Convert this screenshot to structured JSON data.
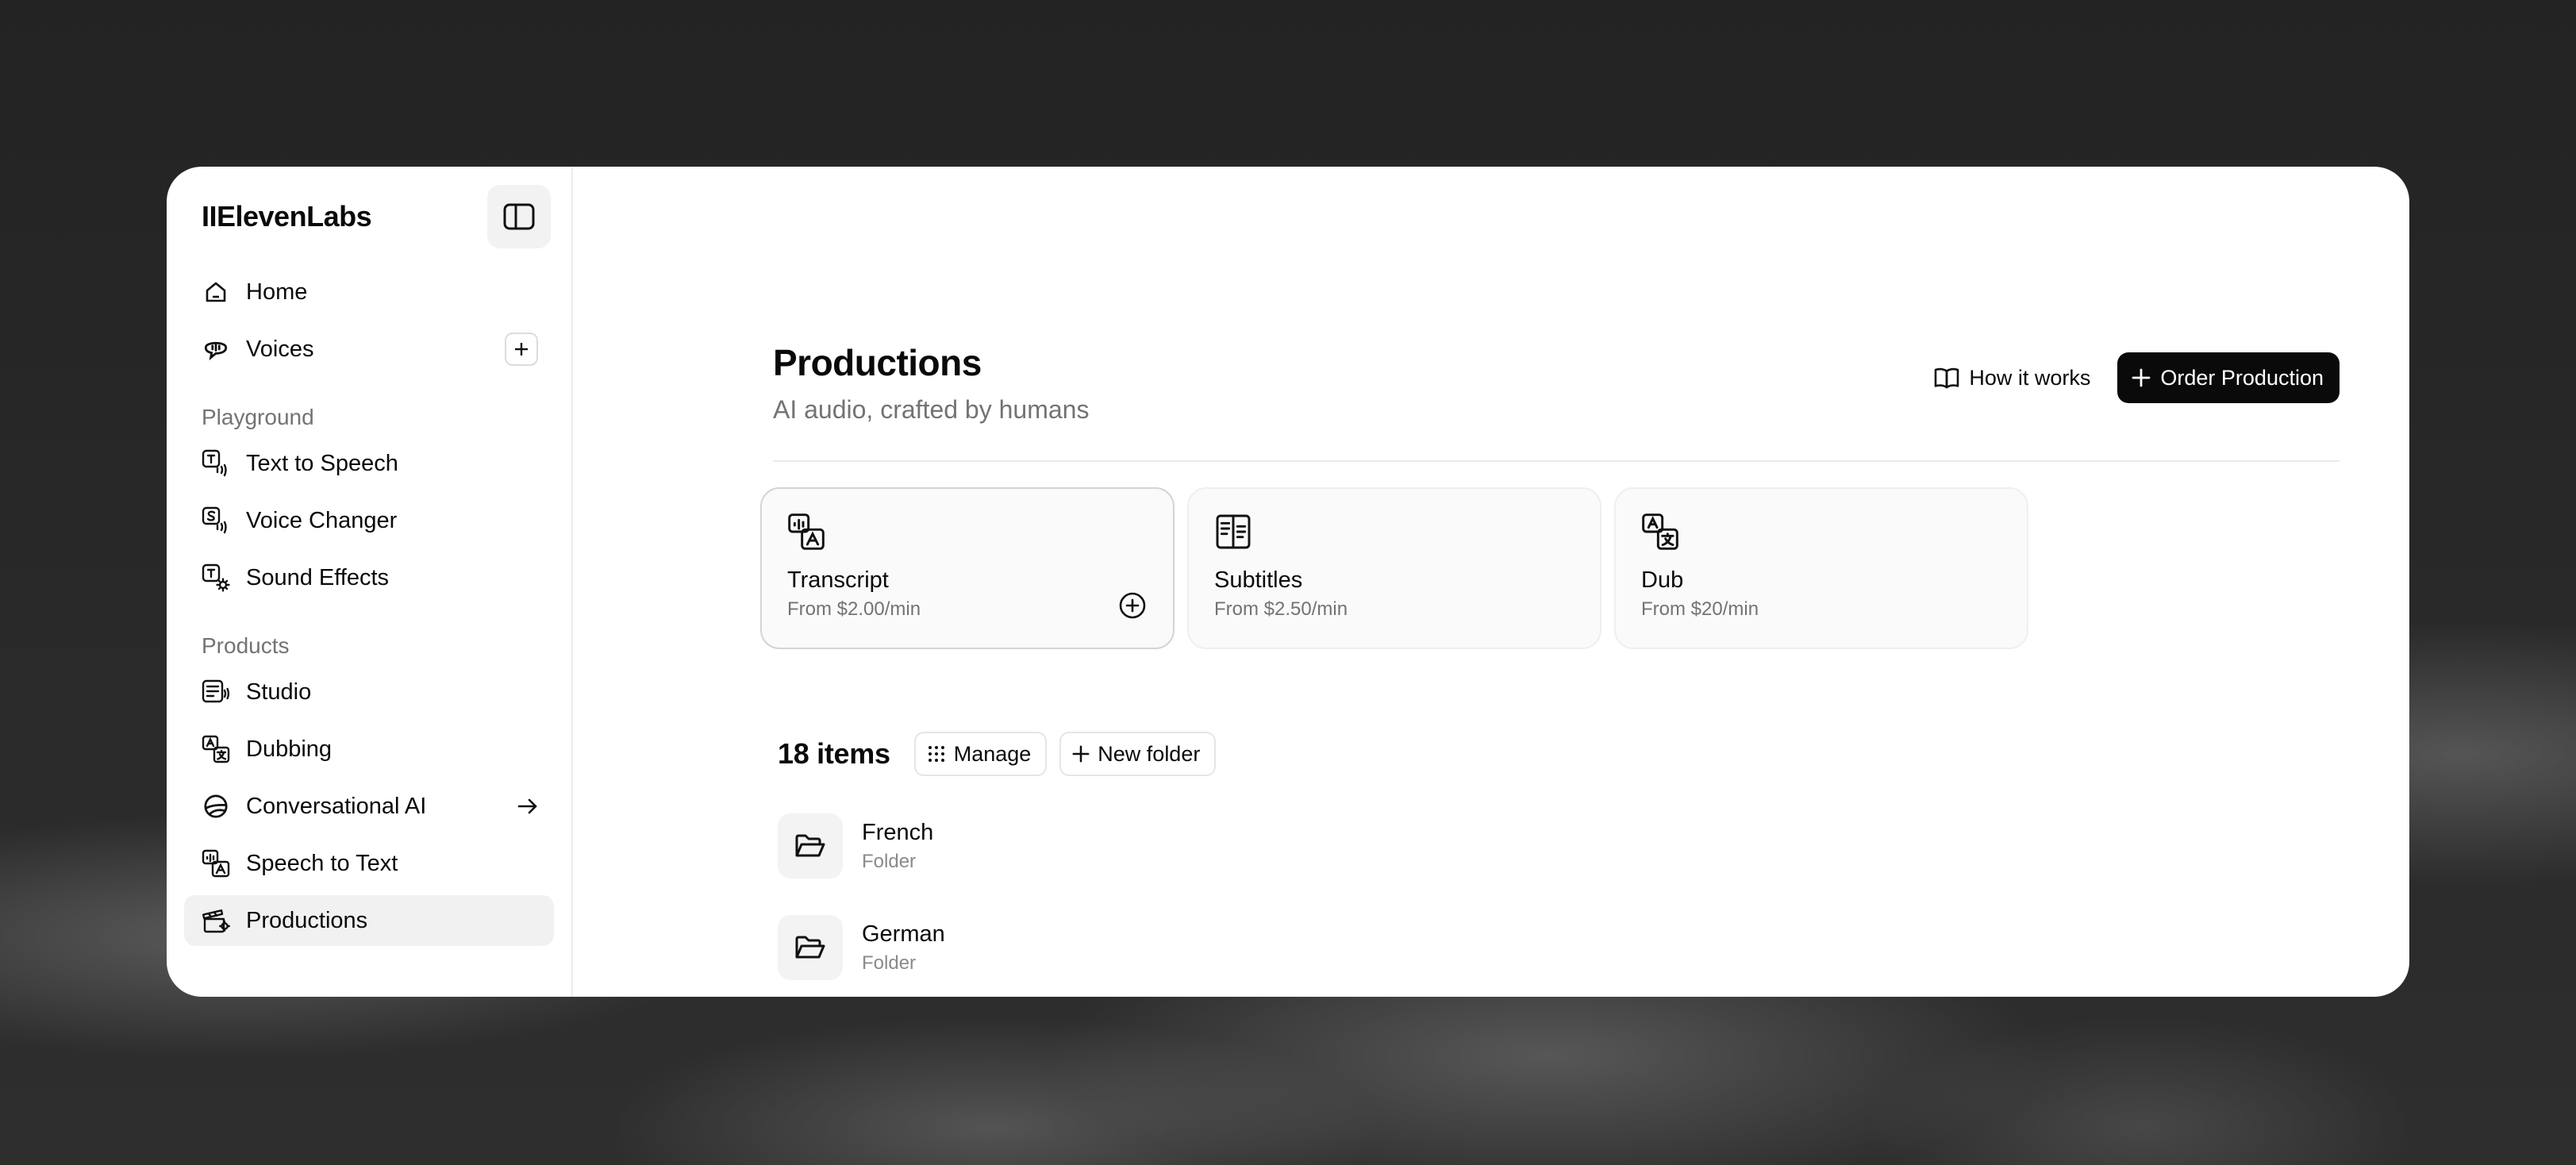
{
  "app": {
    "logo": "IIElevenLabs"
  },
  "sidebar": {
    "top_items": [
      {
        "label": "Home",
        "icon": "home-icon"
      },
      {
        "label": "Voices",
        "icon": "voices-icon"
      }
    ],
    "playground_label": "Playground",
    "playground_items": [
      {
        "label": "Text to Speech",
        "icon": "text-to-speech-icon"
      },
      {
        "label": "Voice Changer",
        "icon": "voice-changer-icon"
      },
      {
        "label": "Sound Effects",
        "icon": "sound-effects-icon"
      }
    ],
    "products_label": "Products",
    "product_items": [
      {
        "label": "Studio",
        "icon": "studio-icon"
      },
      {
        "label": "Dubbing",
        "icon": "dubbing-icon"
      },
      {
        "label": "Conversational AI",
        "icon": "conversational-ai-icon"
      },
      {
        "label": "Speech to Text",
        "icon": "speech-to-text-icon"
      },
      {
        "label": "Productions",
        "icon": "productions-icon",
        "active": true
      }
    ]
  },
  "header": {
    "title": "Productions",
    "subtitle": "AI audio, crafted by humans",
    "how_it_works": "How it works",
    "order_production": "Order Production"
  },
  "cards": [
    {
      "title": "Transcript",
      "price": "From $2.00/min",
      "icon": "transcript-icon",
      "selected": true
    },
    {
      "title": "Subtitles",
      "price": "From $2.50/min",
      "icon": "subtitles-icon"
    },
    {
      "title": "Dub",
      "price": "From $20/min",
      "icon": "dub-icon"
    }
  ],
  "list": {
    "count": "18 items",
    "manage": "Manage",
    "new_folder": "New folder",
    "items": [
      {
        "name": "French",
        "type": "Folder"
      },
      {
        "name": "German",
        "type": "Folder"
      }
    ]
  }
}
